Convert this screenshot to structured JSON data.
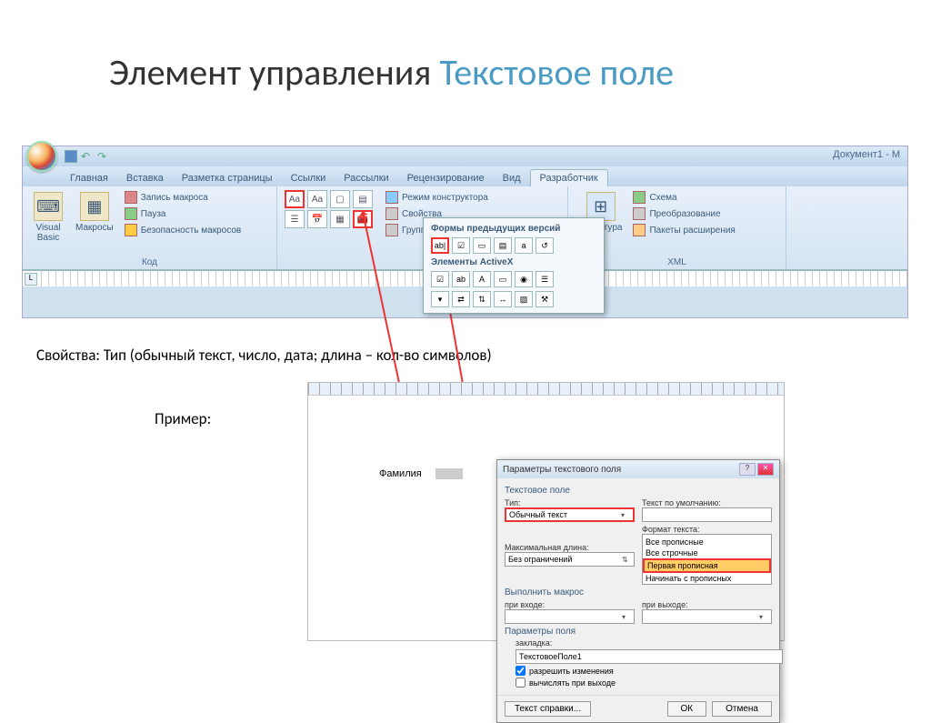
{
  "slide": {
    "title_part1": "Элемент управления ",
    "title_part2": "Текстовое поле",
    "properties_line": "Свойства: Тип (обычный текст, число, дата; длина – кол-во символов)",
    "example_label": "Пример:"
  },
  "word": {
    "doc_title": "Документ1 - M",
    "tabs": [
      "Главная",
      "Вставка",
      "Разметка страницы",
      "Ссылки",
      "Рассылки",
      "Рецензирование",
      "Вид",
      "Разработчик"
    ],
    "active_tab": "Разработчик",
    "groups": {
      "code": {
        "label": "Код",
        "visual_basic": "Visual\nBasic",
        "macros": "Макросы",
        "record": "Запись макроса",
        "pause": "Пауза",
        "security": "Безопасность макросов"
      },
      "controls": {
        "design_mode": "Режим конструктора",
        "properties": "Свойства",
        "group": "Группировать"
      },
      "structure": {
        "label": "XML",
        "structure": "Структура",
        "schema": "Схема",
        "transform": "Преобразование",
        "packages": "Пакеты расширения"
      }
    },
    "popup": {
      "legacy_title": "Формы предыдущих версий",
      "activex_title": "Элементы ActiveX"
    }
  },
  "sample": {
    "field_label": "Фамилия"
  },
  "dialog": {
    "title": "Параметры текстового поля",
    "group_field": "Текстовое поле",
    "type_lbl": "Тип:",
    "type_val": "Обычный текст",
    "default_lbl": "Текст по умолчанию:",
    "maxlen_lbl": "Максимальная длина:",
    "maxlen_val": "Без ограничений",
    "format_lbl": "Формат текста:",
    "format_options": [
      "",
      "Все прописные",
      "Все строчные",
      "Первая прописная",
      "Начинать с прописных"
    ],
    "format_selected": "Первая прописная",
    "macro_group": "Выполнить макрос",
    "on_enter": "при входе:",
    "on_exit": "при выходе:",
    "params_group": "Параметры поля",
    "bookmark_lbl": "закладка:",
    "bookmark_val": "ТекстовоеПоле1",
    "allow_changes": "разрешить изменения",
    "calc_on_exit": "вычислять при выходе",
    "help_btn": "Текст справки...",
    "ok": "ОК",
    "cancel": "Отмена"
  }
}
